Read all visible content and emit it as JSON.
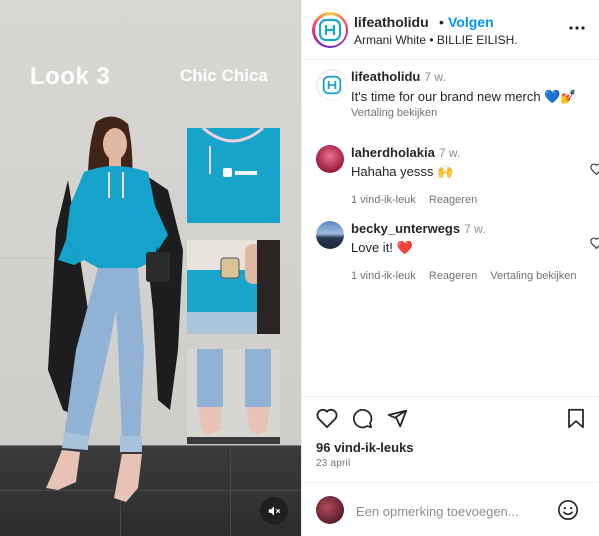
{
  "media": {
    "look_title": "Look 3",
    "look_subtitle": "Chic Chica",
    "mute_icon": "speaker-muted-icon"
  },
  "post": {
    "username": "lifeatholidu",
    "separator": "•",
    "follow_label": "Volgen",
    "audio_artist": "Armani White",
    "audio_separator": "•",
    "audio_track": "BILLIE EILISH.",
    "more_icon": "more-horizontal-icon"
  },
  "caption": {
    "username": "lifeatholidu",
    "time": "7 w.",
    "text": "It's time for our brand new merch 💙💅",
    "translate_label": "Vertaling bekijken"
  },
  "comments": [
    {
      "username": "laherdholakia",
      "time": "7 w.",
      "text": "Hahaha yesss 🙌",
      "likes_label": "1 vind-ik-leuk",
      "reply_label": "Reageren"
    },
    {
      "username": "becky_unterwegs",
      "time": "7 w.",
      "text": "Love it! ❤️",
      "likes_label": "1 vind-ik-leuk",
      "reply_label": "Reageren",
      "translate_label": "Vertaling bekijken"
    }
  ],
  "footer": {
    "likes": "96 vind-ik-leuks",
    "date": "23 april",
    "comment_placeholder": "Een opmerking toevoegen...",
    "icons": [
      "heart-icon",
      "comment-icon",
      "share-icon",
      "bookmark-icon",
      "emoji-icon"
    ]
  },
  "colors": {
    "follow_blue": "#0095f6",
    "brand_teal": "#1aa6cc",
    "like_red": "#ed4956"
  }
}
